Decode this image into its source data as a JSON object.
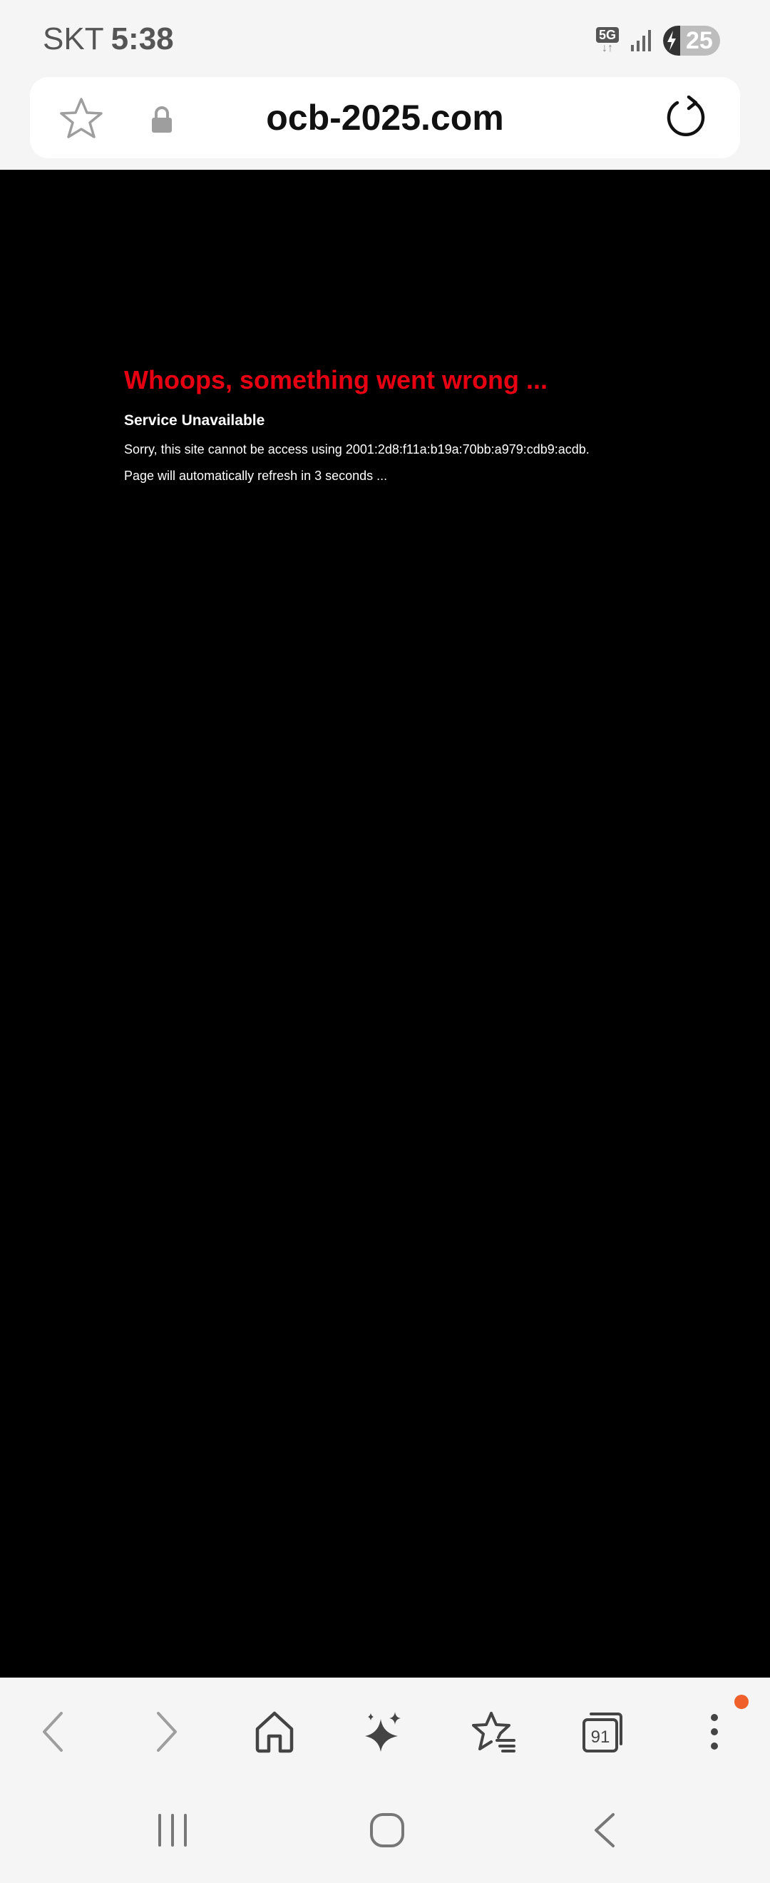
{
  "status_bar": {
    "carrier": "SKT",
    "time": "5:38",
    "network": "5G",
    "battery": "25",
    "icons": [
      "5g-icon",
      "signal-icon",
      "battery-charging-icon"
    ]
  },
  "url_bar": {
    "url": "ocb-2025.com",
    "icons": [
      "star-icon",
      "lock-icon",
      "reload-icon"
    ]
  },
  "page": {
    "title": "Whoops, something went wrong ...",
    "subtitle": "Service Unavailable",
    "message": "Sorry, this site cannot be access using 2001:2d8:f11a:b19a:70bb:a979:cdb9:acdb.",
    "refresh_note": "Page will automatically refresh in 3 seconds ...",
    "title_color": "#e60012",
    "background": "#000000"
  },
  "toolbar": {
    "tabs_count": "91",
    "buttons": [
      "back-icon",
      "forward-icon",
      "home-icon",
      "sparkle-icon",
      "bookmarks-icon",
      "tabs-icon",
      "more-icon"
    ],
    "notification_color": "#f0602a"
  },
  "navigation": {
    "buttons": [
      "recent-apps-icon",
      "home-circle-icon",
      "system-back-icon"
    ]
  }
}
